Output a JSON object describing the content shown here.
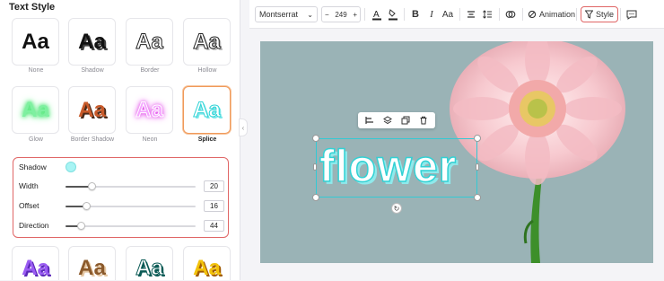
{
  "panel": {
    "title": "Text Style",
    "sample_text": "Aa",
    "styles": [
      {
        "label": "None",
        "cls": "s-none"
      },
      {
        "label": "Shadow",
        "cls": "s-shadow"
      },
      {
        "label": "Border",
        "cls": "s-border"
      },
      {
        "label": "Hollow",
        "cls": "s-hollow"
      },
      {
        "label": "Glow",
        "cls": "s-glow"
      },
      {
        "label": "Border Shadow",
        "cls": "s-bshadow"
      },
      {
        "label": "Neon",
        "cls": "s-neon"
      },
      {
        "label": "Splice",
        "cls": "s-splice",
        "selected": true
      }
    ],
    "more_styles": [
      {
        "cls": "s-purple"
      },
      {
        "cls": "s-brown"
      },
      {
        "cls": "s-teal"
      },
      {
        "cls": "s-gold"
      }
    ]
  },
  "shadow": {
    "label": "Shadow",
    "color": "#a8f4f4",
    "width_label": "Width",
    "width_value": "20",
    "width_fraction": 0.2,
    "offset_label": "Offset",
    "offset_value": "16",
    "offset_fraction": 0.16,
    "direction_label": "Direction",
    "direction_value": "44",
    "direction_fraction": 0.12
  },
  "toolbar": {
    "font": "Montserrat",
    "font_size": "249",
    "minus": "−",
    "plus": "+",
    "animation_label": "Animation",
    "style_label": "Style"
  },
  "canvas": {
    "text": "flower",
    "background": "#9ab3b6",
    "accent": "#33d1d4"
  }
}
